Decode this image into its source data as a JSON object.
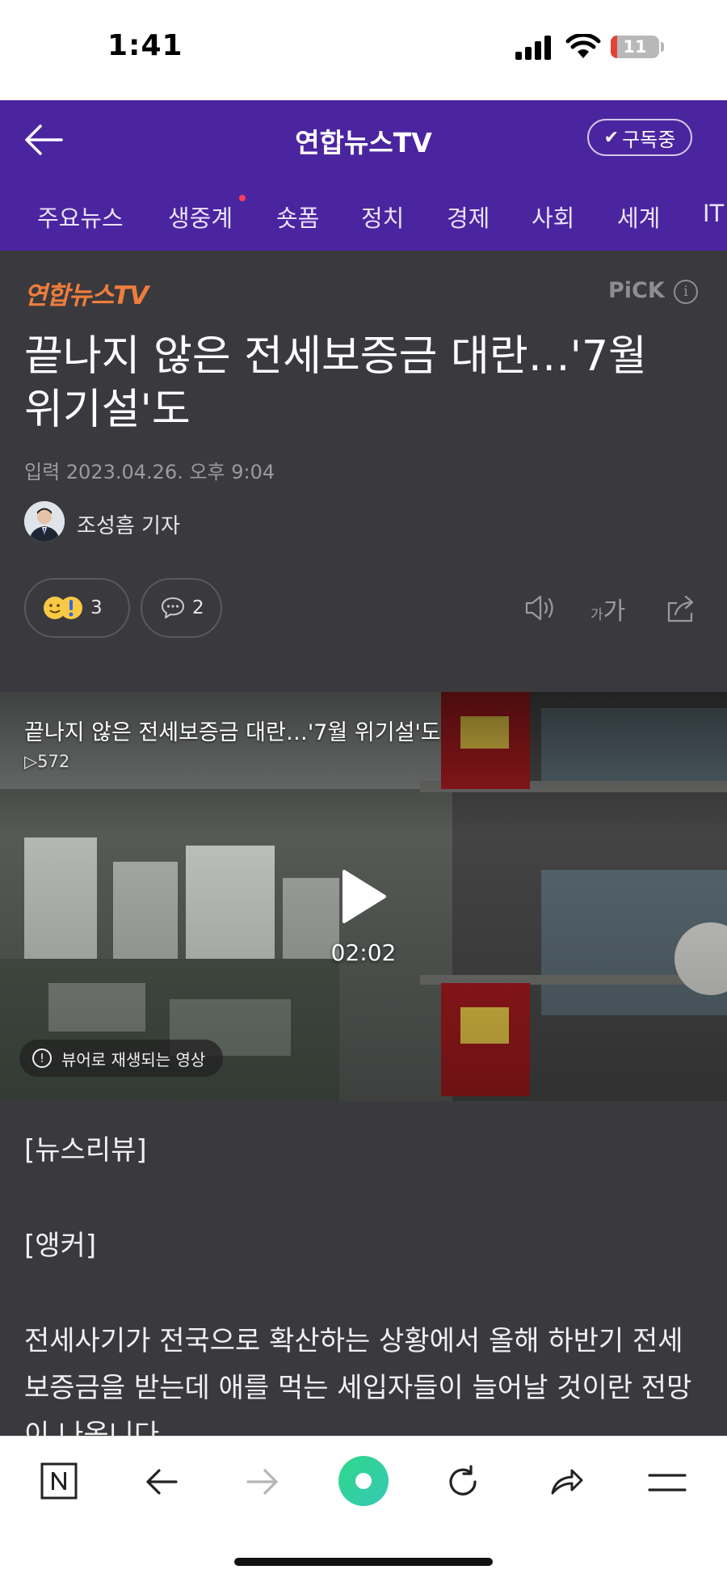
{
  "status_bar": {
    "time": "1:41",
    "battery": "11"
  },
  "app_bar": {
    "title": "연합뉴스TV",
    "subscribe_label": "구독중"
  },
  "tabs": [
    "주요뉴스",
    "생중계",
    "숏폼",
    "정치",
    "경제",
    "사회",
    "세계",
    "IT"
  ],
  "article": {
    "press": "연합뉴스TV",
    "pick_label": "PiCK",
    "headline": "끝나지 않은 전세보증금 대란…'7월 위기설'도",
    "date": "입력 2023.04.26. 오후 9:04",
    "reporter": "조성흠 기자",
    "reaction_count": "3",
    "comment_count": "2",
    "font_size_label": "가가"
  },
  "video": {
    "title": "끝나지 않은 전세보증금 대란…'7월 위기설'도",
    "views": "572",
    "duration": "02:02",
    "viewer_notice": "뷰어로 재생되는 영상"
  },
  "body": {
    "p1": "[뉴스리뷰]",
    "p2": "[앵커]",
    "p3_line1": "전세사기가 전국으로 확산하는 상황에서 올해 하반기 전세",
    "p3_line2": "보증금을 받는데 애를 먹는 세입자들이 늘어날 것이란 전망",
    "p3_line3": "이 나옵니다."
  },
  "icons": [
    "back-arrow-icon",
    "check-icon",
    "info-icon",
    "reaction-emoji-icon",
    "comment-icon",
    "speaker-icon",
    "font-size-icon",
    "share-icon",
    "play-icon",
    "naver-n-icon",
    "green-dot-icon",
    "refresh-icon",
    "hamburger-icon"
  ],
  "colors": {
    "brand_purple": "#4b25a0",
    "press_orange": "#f07d3c",
    "article_bg": "#3a3a3e",
    "live_dot": "#ff3b5c",
    "green_button": "#2fd88a"
  }
}
